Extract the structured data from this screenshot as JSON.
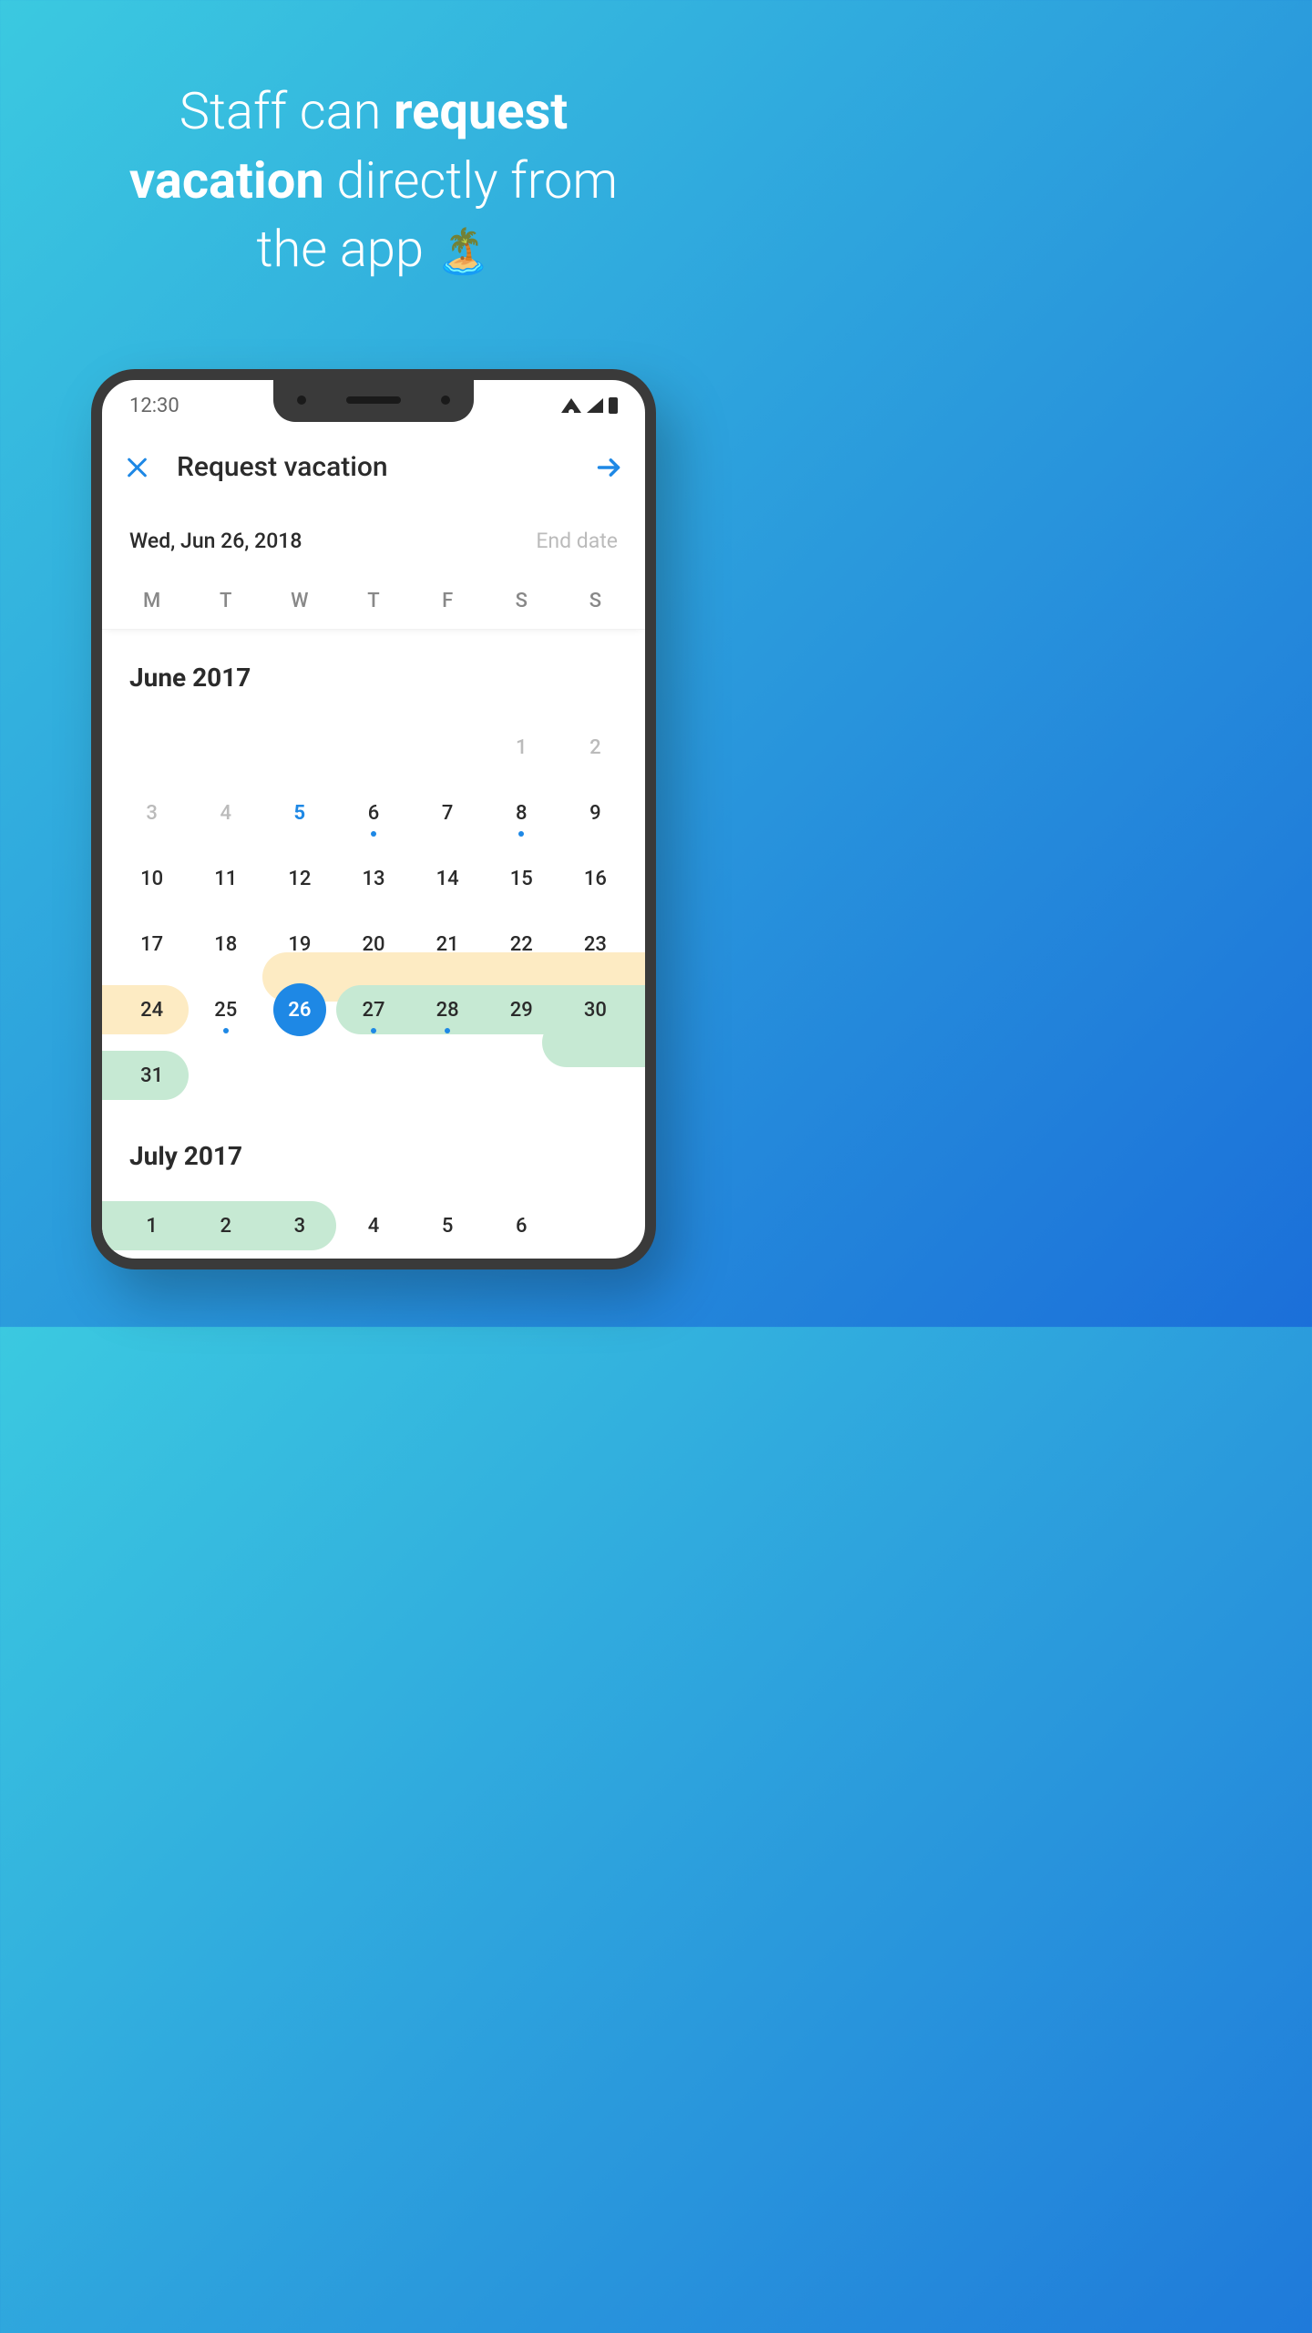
{
  "hero": {
    "line1_pre": "Staff can ",
    "line1_bold": "request",
    "line2_bold": "vacation",
    "line2_post": " directly from",
    "line3": "the app ",
    "emoji": "🏝️"
  },
  "status": {
    "time": "12:30"
  },
  "header": {
    "title": "Request vacation"
  },
  "dates": {
    "start": "Wed, Jun 26, 2018",
    "end_placeholder": "End date"
  },
  "dow": [
    "M",
    "T",
    "W",
    "T",
    "F",
    "S",
    "S"
  ],
  "months": {
    "june": {
      "title": "June 2017",
      "leading_blanks": 5,
      "days": [
        {
          "n": 1,
          "dim": true
        },
        {
          "n": 2,
          "dim": true
        },
        {
          "n": 3,
          "dim": true
        },
        {
          "n": 4,
          "dim": true
        },
        {
          "n": 5,
          "accent": true
        },
        {
          "n": 6,
          "dot": true
        },
        {
          "n": 7
        },
        {
          "n": 8,
          "dot": true
        },
        {
          "n": 9
        },
        {
          "n": 10
        },
        {
          "n": 11
        },
        {
          "n": 12
        },
        {
          "n": 13
        },
        {
          "n": 14
        },
        {
          "n": 15
        },
        {
          "n": 16
        },
        {
          "n": 17
        },
        {
          "n": 18
        },
        {
          "n": 19
        },
        {
          "n": 20
        },
        {
          "n": 21
        },
        {
          "n": 22
        },
        {
          "n": 23
        },
        {
          "n": 24
        },
        {
          "n": 25,
          "dot": true
        },
        {
          "n": 26,
          "selected": true
        },
        {
          "n": 27,
          "dot": true
        },
        {
          "n": 28,
          "dot": true
        },
        {
          "n": 29
        },
        {
          "n": 30
        },
        {
          "n": 31
        }
      ]
    },
    "july": {
      "title": "July 2017",
      "leading_blanks": 0,
      "days": [
        {
          "n": 1
        },
        {
          "n": 2
        },
        {
          "n": 3
        },
        {
          "n": 4
        },
        {
          "n": 5
        },
        {
          "n": 6
        }
      ]
    }
  },
  "colors": {
    "accent": "#1E88E5",
    "range_yellow": "#FDEBC3",
    "range_green": "#C6E9D3"
  }
}
